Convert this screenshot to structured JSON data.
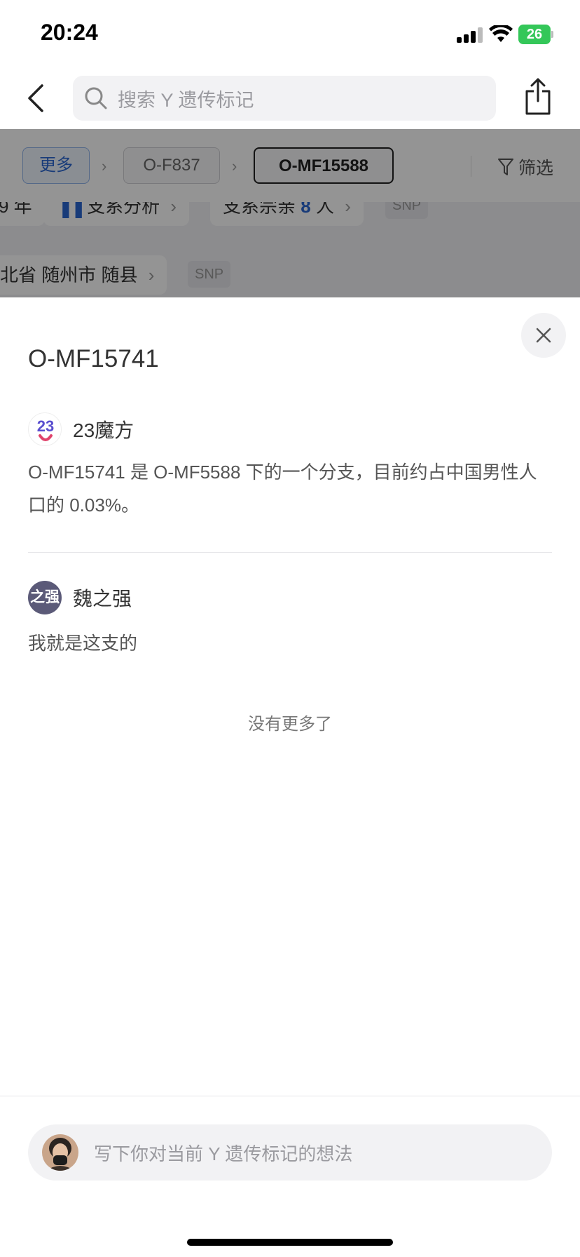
{
  "status_bar": {
    "time": "20:24",
    "battery": "26"
  },
  "search": {
    "placeholder": "搜索 Y 遗传标记"
  },
  "breadcrumb": {
    "more_label": "更多",
    "items": [
      "O-F837",
      "O-MF15588"
    ],
    "filter_label": "筛选"
  },
  "background_rows": {
    "row1": {
      "left_fragment": "9 年",
      "analysis_label": "支系分析",
      "members_prefix": "支系宗亲",
      "members_count": "8",
      "members_suffix": "人",
      "snp_label": "SNP"
    },
    "row2": {
      "location": "北省 随州市 随县",
      "snp_label": "SNP"
    }
  },
  "sheet": {
    "title": "O-MF15741",
    "comments": [
      {
        "author": "23魔方",
        "text": "O-MF15741 是 O-MF5588 下的一个分支，目前约占中国男性人口的 0.03%。"
      },
      {
        "author": "魏之强",
        "avatar_text": "之强",
        "text": "我就是这支的"
      }
    ],
    "no_more": "没有更多了"
  },
  "comment_input": {
    "placeholder": "写下你对当前 Y 遗传标记的想法"
  },
  "colors": {
    "accent_blue": "#2a66d0",
    "battery_green": "#34c759"
  }
}
